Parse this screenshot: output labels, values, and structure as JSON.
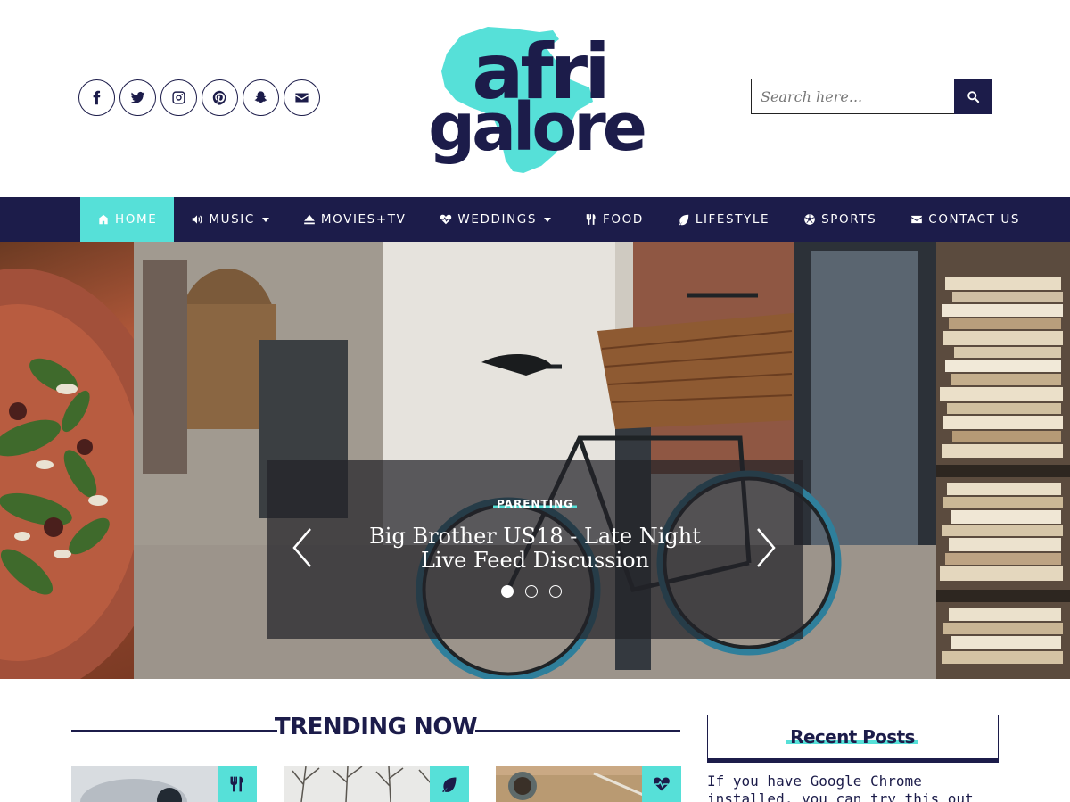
{
  "header": {
    "logo": {
      "line1": "afri",
      "line2": "galore"
    },
    "social": [
      {
        "name": "facebook-icon"
      },
      {
        "name": "twitter-icon"
      },
      {
        "name": "instagram-icon"
      },
      {
        "name": "pinterest-icon"
      },
      {
        "name": "snapchat-icon"
      },
      {
        "name": "envelope-icon"
      }
    ],
    "search": {
      "placeholder": "Search here..."
    }
  },
  "nav": {
    "items": [
      {
        "label": "HOME",
        "icon": "home-icon",
        "active": true,
        "dropdown": false
      },
      {
        "label": "MUSIC",
        "icon": "volume-icon",
        "active": false,
        "dropdown": true
      },
      {
        "label": "MOVIES+TV",
        "icon": "eject-icon",
        "active": false,
        "dropdown": false
      },
      {
        "label": "WEDDINGS",
        "icon": "heartbeat-icon",
        "active": false,
        "dropdown": true
      },
      {
        "label": "FOOD",
        "icon": "cutlery-icon",
        "active": false,
        "dropdown": false
      },
      {
        "label": "LIFESTYLE",
        "icon": "leaf-icon",
        "active": false,
        "dropdown": false
      },
      {
        "label": "SPORTS",
        "icon": "soccer-ball-icon",
        "active": false,
        "dropdown": false
      },
      {
        "label": "CONTACT US",
        "icon": "envelope-icon",
        "active": false,
        "dropdown": false
      }
    ]
  },
  "slider": {
    "category": "PARENTING",
    "title_line1": "Big Brother US18 - Late Night",
    "title_line2": "Live Feed Discussion",
    "active_dot": 1,
    "dot_count": 3
  },
  "trending": {
    "title": "TRENDING NOW",
    "cards": [
      {
        "icon": "cutlery-icon"
      },
      {
        "icon": "leaf-icon"
      },
      {
        "icon": "heartbeat-icon"
      }
    ]
  },
  "sidebar": {
    "recent_title": "Recent Posts",
    "recent_text": "If you have Google Chrome installed, you can try this out"
  },
  "colors": {
    "navy": "#1c1c4a",
    "accent": "#56e0d8"
  }
}
